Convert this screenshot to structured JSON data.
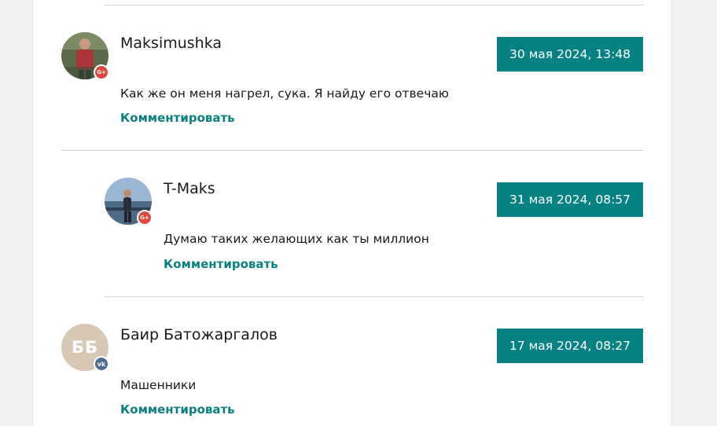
{
  "theme": {
    "accent": "#078181",
    "link": "#0b7f7f",
    "divider": "#cfcfcf"
  },
  "comments": [
    {
      "author": "Maksimushka",
      "date": "30 мая 2024, 13:48",
      "text": "Как же он меня нагрел, сука. Я найду его отвечаю",
      "reply_label": "Комментировать",
      "network": "google-plus-icon",
      "network_badge": "G+",
      "avatar": "user-photo"
    },
    {
      "author": "T-Maks",
      "date": "31 мая 2024, 08:57",
      "text": "Думаю таких желающих как ты миллион",
      "reply_label": "Комментировать",
      "network": "google-plus-icon",
      "network_badge": "G+",
      "avatar": "user-photo"
    },
    {
      "author": "Баир Батожаргалов",
      "date": "17 мая 2024, 08:27",
      "text": "Машенники",
      "reply_label": "Комментировать",
      "network": "vk-icon",
      "network_badge": "vk",
      "avatar_initials": "ББ"
    }
  ]
}
